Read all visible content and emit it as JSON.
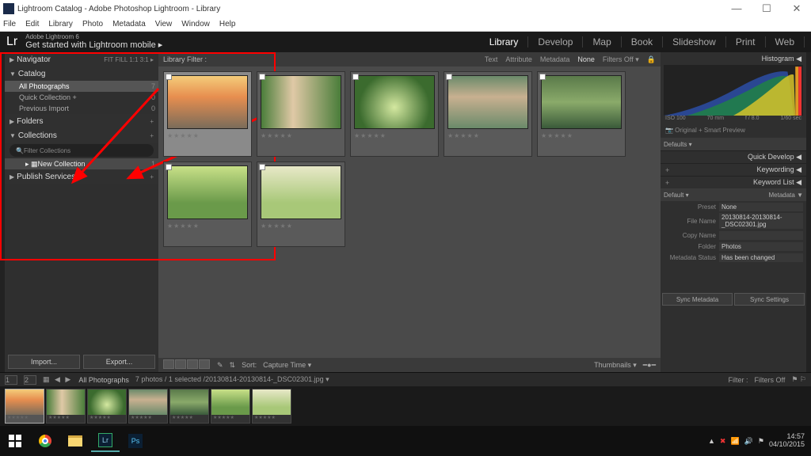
{
  "titlebar": "Lightroom Catalog - Adobe Photoshop Lightroom - Library",
  "menubar": [
    "File",
    "Edit",
    "Library",
    "Photo",
    "Metadata",
    "View",
    "Window",
    "Help"
  ],
  "identity": {
    "line1": "Adobe Lightroom 6",
    "line2": "Get started with Lightroom mobile  ▸"
  },
  "modules": [
    "Library",
    "Develop",
    "Map",
    "Book",
    "Slideshow",
    "Print",
    "Web"
  ],
  "active_module": "Library",
  "left": {
    "navigator": {
      "label": "Navigator",
      "modes": "FIT   FILL   1:1   3:1 ▸"
    },
    "catalog": {
      "label": "Catalog",
      "items": [
        {
          "label": "All Photographs",
          "count": "7",
          "sel": true
        },
        {
          "label": "Quick Collection  +",
          "count": "0"
        },
        {
          "label": "Previous Import",
          "count": "0"
        }
      ]
    },
    "folders": {
      "label": "Folders",
      "add": "+"
    },
    "collections": {
      "label": "Collections",
      "add": "+",
      "filter_placeholder": "Filter Collections",
      "items": [
        {
          "label": "New Collection",
          "count": "1"
        }
      ]
    },
    "publish": {
      "label": "Publish Services",
      "add": "+"
    },
    "import_btn": "Import...",
    "export_btn": "Export..."
  },
  "library_filter": {
    "label": "Library Filter :",
    "tabs": [
      "Text",
      "Attribute",
      "Metadata"
    ],
    "none": "None",
    "off": "Filters Off ▾"
  },
  "grid": {
    "rows": [
      [
        {
          "sel": true,
          "cls": "th1"
        },
        {
          "cls": "th2"
        },
        {
          "cls": "th3"
        },
        {
          "cls": "th4"
        },
        {
          "cls": "th5"
        }
      ],
      [
        {
          "cls": "th6"
        },
        {
          "cls": "th7"
        }
      ]
    ]
  },
  "toolbar": {
    "sort_label": "Sort:",
    "sort_value": "Capture Time ▾",
    "thumbnails": "Thumbnails ▾"
  },
  "right": {
    "histogram": {
      "label": "Histogram ◀",
      "iso": "ISO 100",
      "focal": "70 mm",
      "ap": "f / 8.0",
      "ss": "1/60 sec",
      "preview": "📷 Original + Smart Preview"
    },
    "defaults": "Defaults ▾",
    "quick_develop": "Quick Develop ◀",
    "keywording": "Keywording ◀",
    "keyword_list": "Keyword List ◀",
    "metadata": {
      "label": "Metadata ▼",
      "mode": "Default ▾",
      "preset_k": "Preset",
      "preset_v": "None",
      "filename_k": "File Name",
      "filename_v": "20130814-20130814-_DSC02301.jpg",
      "copyname_k": "Copy Name",
      "copyname_v": "",
      "folder_k": "Folder",
      "folder_v": "Photos",
      "status_k": "Metadata Status",
      "status_v": "Has been changed"
    },
    "sync_meta": "Sync Metadata",
    "sync_settings": "Sync Settings"
  },
  "filmstrip": {
    "screens": [
      "1",
      "2"
    ],
    "breadcrumb": "All Photographs",
    "info": "7 photos / 1 selected /20130814-20130814-_DSC02301.jpg ▾",
    "filter_label": "Filter :",
    "filter_value": "Filters Off",
    "thumbs": [
      "th1",
      "th2",
      "th3",
      "th4",
      "th5",
      "th6",
      "th7"
    ]
  },
  "tray": {
    "time": "14:57",
    "date": "04/10/2015"
  }
}
